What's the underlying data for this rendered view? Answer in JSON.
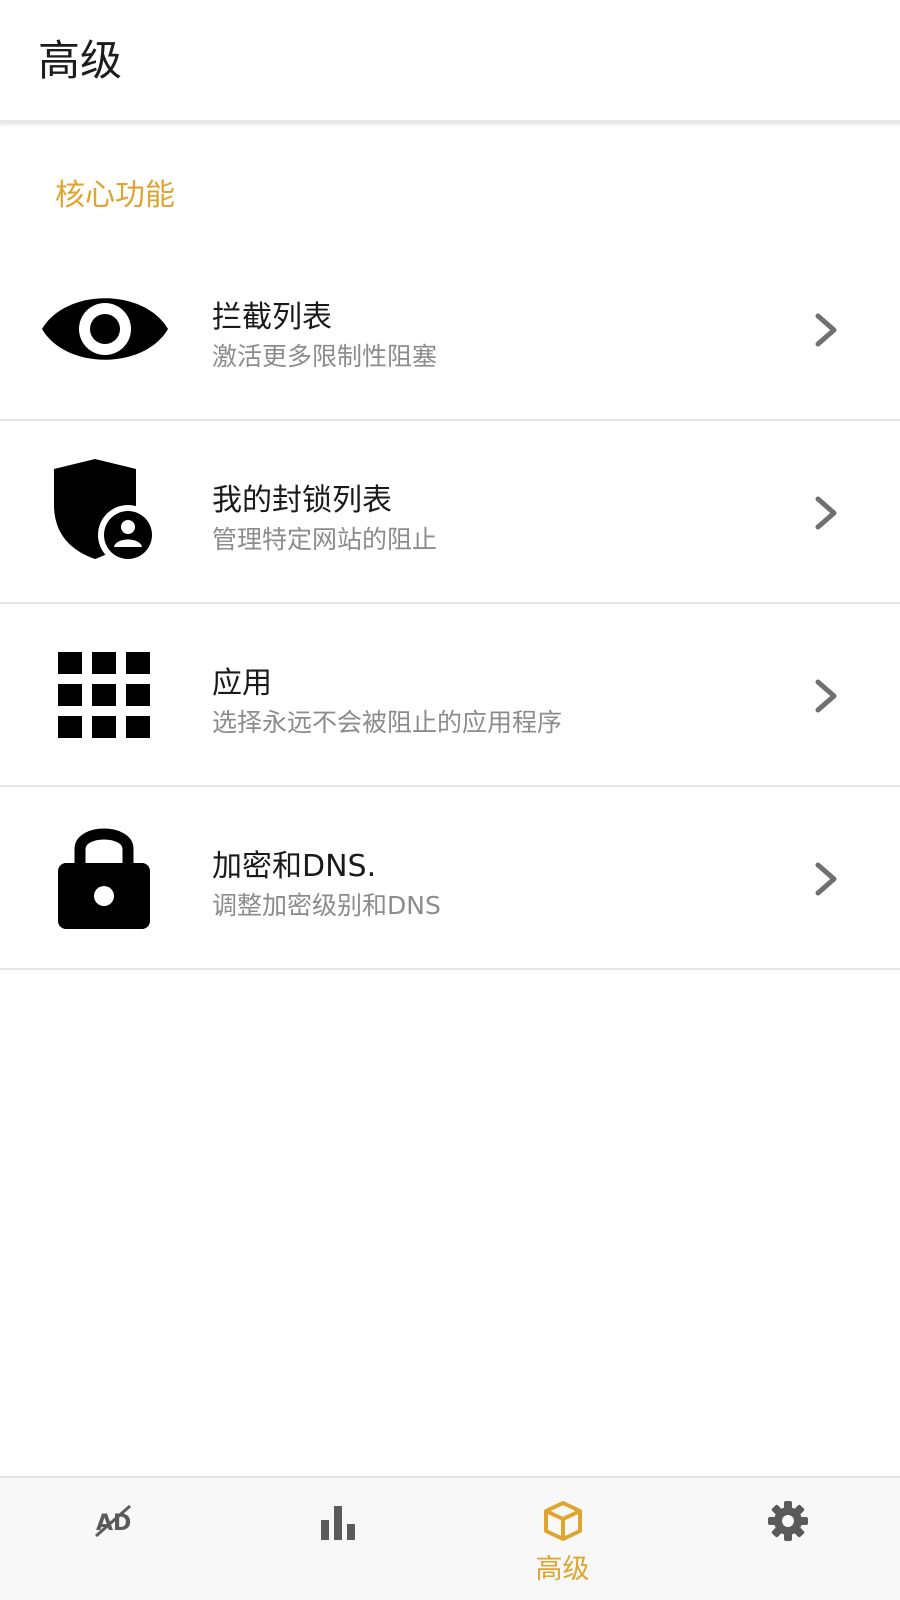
{
  "app_bar": {
    "title": "高级"
  },
  "section": {
    "header": "核心功能"
  },
  "items": [
    {
      "title": "拦截列表",
      "subtitle": "激活更多限制性阻塞",
      "icon": "eye-icon"
    },
    {
      "title": "我的封锁列表",
      "subtitle": "管理特定网站的阻止",
      "icon": "shield-user-icon"
    },
    {
      "title": "应用",
      "subtitle": "选择永远不会被阻止的应用程序",
      "icon": "apps-grid-icon"
    },
    {
      "title": "加密和DNS.",
      "subtitle": "调整加密级别和DNS",
      "icon": "lock-icon"
    }
  ],
  "bottom_nav": {
    "items": [
      {
        "icon": "ad-block-icon",
        "label": ""
      },
      {
        "icon": "stats-bar-icon",
        "label": ""
      },
      {
        "icon": "box-icon",
        "label": "高级",
        "active": true
      },
      {
        "icon": "gear-icon",
        "label": ""
      }
    ]
  },
  "colors": {
    "accent": "#e0a52e",
    "text_primary": "#1a1a1a",
    "text_secondary": "#8c8c8c",
    "icon": "#000000",
    "chevron": "#707070",
    "nav_inactive": "#5a5a5a"
  }
}
